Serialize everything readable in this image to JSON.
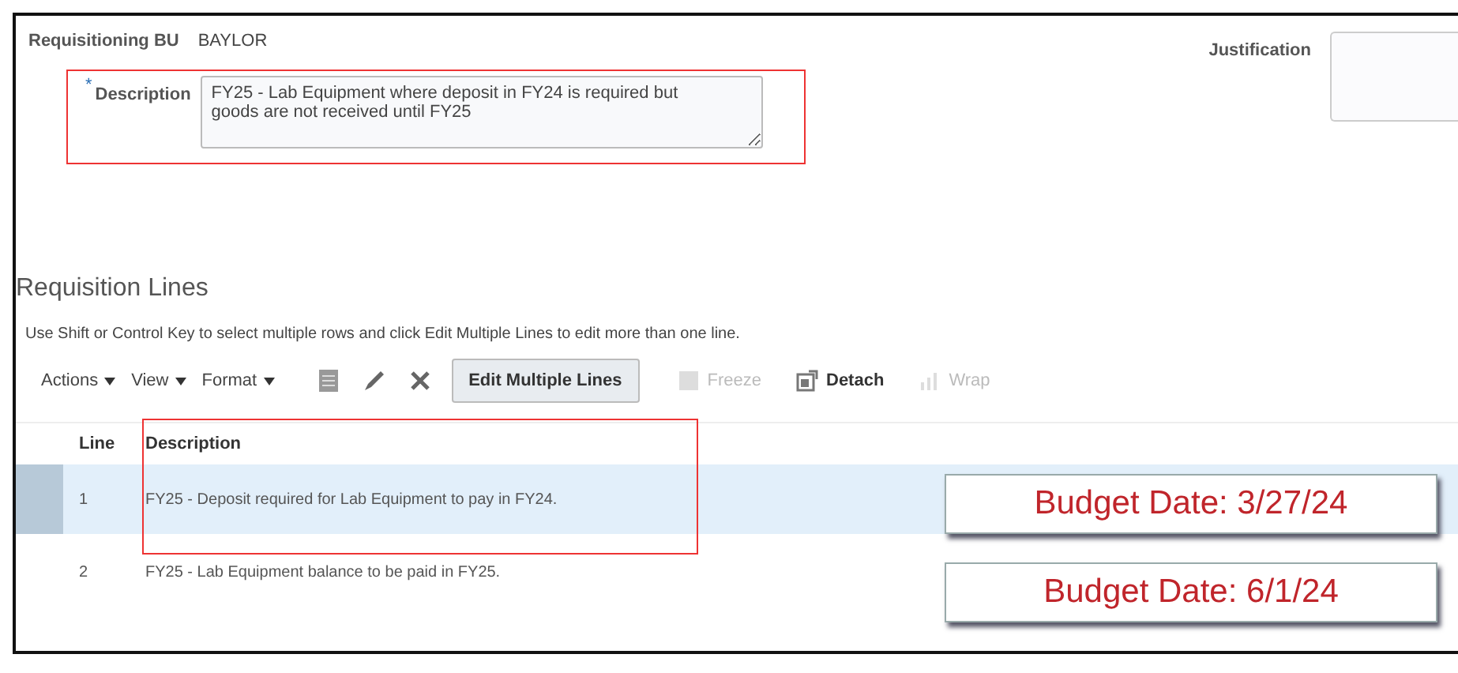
{
  "header": {
    "business_unit": {
      "label": "Requisitioning BU",
      "value": "BAYLOR"
    },
    "justification": {
      "label": "Justification"
    },
    "description": {
      "label": "Description",
      "required_mark": "*",
      "value": "FY25 - Lab Equipment where deposit in FY24 is required but goods are not received until FY25"
    }
  },
  "lines": {
    "title": "Requisition Lines",
    "hint": "Use Shift or Control Key to select multiple rows and click Edit Multiple Lines to edit more than one line.",
    "menus": [
      "Actions",
      "View",
      "Format"
    ],
    "tools": [
      {
        "kind": "sheet",
        "disabled": false
      },
      {
        "kind": "pencil",
        "disabled": false
      },
      {
        "kind": "delete",
        "disabled": false
      }
    ],
    "button": "Edit Multiple Lines",
    "actions": [
      {
        "label": "Freeze",
        "kind": "freeze",
        "disabled": true
      },
      {
        "label": "Detach",
        "kind": "detach",
        "disabled": false
      },
      {
        "label": "Wrap",
        "kind": "wrap",
        "disabled": true
      }
    ],
    "columns": [
      "Line",
      "Description"
    ],
    "rows": [
      {
        "line": "1",
        "description": "FY25 - Deposit required for Lab Equipment to pay in FY24.",
        "selected": true,
        "callout": "Budget Date: 3/27/24"
      },
      {
        "line": "2",
        "description": "FY25 - Lab Equipment balance to be paid in FY25.",
        "selected": false,
        "callout": "Budget Date: 6/1/24"
      }
    ]
  }
}
